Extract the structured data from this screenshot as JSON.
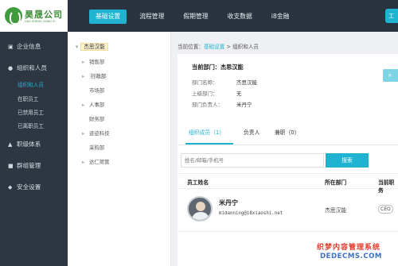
{
  "logo": {
    "name": "昊晟公司",
    "sub": "HAO SHENG GONG SI"
  },
  "topnav": [
    "基础设置",
    "流程管理",
    "假期管理",
    "收支数据",
    "i8金融"
  ],
  "topnav_active": 0,
  "top_right_btn": "工",
  "sidebar": {
    "items": [
      {
        "icon": "▣",
        "label": "企业信息"
      },
      {
        "icon": "●",
        "label": "组织和人员"
      },
      {
        "icon": "▲",
        "label": "职级体系"
      },
      {
        "icon": "■",
        "label": "群组管理"
      },
      {
        "icon": "◆",
        "label": "安全设置"
      }
    ],
    "subitems": [
      "组织和人员",
      "在职员工",
      "已禁用员工",
      "已离职员工"
    ]
  },
  "tree": {
    "root": "杰思汉能",
    "nodes": [
      {
        "label": "销售部",
        "expandable": true
      },
      {
        "label": "行政部",
        "expandable": true
      },
      {
        "label": "市场部",
        "expandable": false
      },
      {
        "label": "人事部",
        "expandable": true
      },
      {
        "label": "财务部",
        "expandable": false
      },
      {
        "label": "迹迹科技",
        "expandable": true
      },
      {
        "label": "采购部",
        "expandable": false
      },
      {
        "label": "达仁荷管",
        "expandable": true
      }
    ]
  },
  "breadcrumb": {
    "prefix": "当前位置：",
    "link": "基础设置",
    "sep": " > ",
    "current": "组织和人员"
  },
  "dept": {
    "title": "当前部门：杰思汉能",
    "rows": [
      {
        "label": "部门名称：",
        "value": "杰思汉能"
      },
      {
        "label": "上级部门：",
        "value": "无"
      },
      {
        "label": "部门负责人：",
        "value": "米丹宁"
      }
    ],
    "edit_btn": "+"
  },
  "tabs": [
    "组织成员（1）",
    "负责人",
    "兼职（0）"
  ],
  "search": {
    "placeholder": "姓名/邮箱/手机号",
    "button": "搜索"
  },
  "table": {
    "headers": [
      "员工姓名",
      "所在部门",
      "当前职务"
    ],
    "rows": [
      {
        "name": "米丹宁",
        "email": "midanning@i8xiaoshi.net",
        "dept": "杰思汉能",
        "tag": "CEO"
      }
    ]
  },
  "watermark": {
    "line1": "织梦内容管理系统",
    "line2": "DEDECMS.COM"
  },
  "colors": {
    "accent": "#1fb3d1",
    "sidebar_bg": "#2d3742",
    "topbar_bg": "#2a3440"
  }
}
